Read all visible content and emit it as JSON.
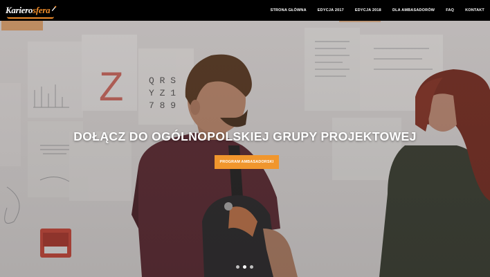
{
  "brand": {
    "logo_part1": "Kariero",
    "logo_part2": "sfera",
    "accent_color": "#f28e2b"
  },
  "nav": {
    "items": [
      {
        "label": "STRONA GŁÓWNA"
      },
      {
        "label": "EDYCJA 2017"
      },
      {
        "label": "EDYCJA 2018"
      },
      {
        "label": "DLA AMBASADORÓW"
      },
      {
        "label": "FAQ"
      },
      {
        "label": "KONTAKT"
      }
    ]
  },
  "hero": {
    "headline": "DOŁĄCZ DO OGÓLNOPOLSKIEJ GRUPY PROJEKTOWEJ",
    "cta_label": "PROGRAM AMBASADORSKI",
    "cta_color": "#f0962d",
    "wall_letters": [
      "Z",
      "Q R S",
      "Y Z 1",
      "7 8 9"
    ],
    "slides": {
      "count": 3,
      "active": 1
    }
  }
}
